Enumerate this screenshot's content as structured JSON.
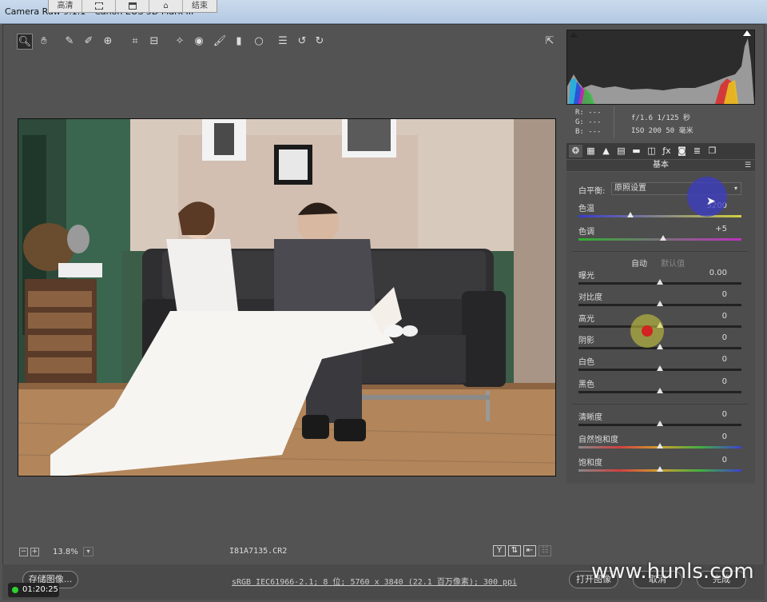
{
  "window": {
    "title": "Camera Raw 9.1.1 - Canon EOS 5D Mark III"
  },
  "recorder": {
    "buttons": [
      "高清",
      "",
      "",
      "",
      "结束"
    ]
  },
  "toolbar": {
    "tools": [
      "zoom-icon",
      "hand-icon",
      "white-balance-icon",
      "color-sampler-icon",
      "target-adjust-icon",
      "crop-icon",
      "straighten-icon",
      "spot-removal-icon",
      "red-eye-icon",
      "adjustment-brush-icon",
      "graduated-filter-icon",
      "radial-filter-icon",
      "preferences-icon",
      "rotate-left-icon",
      "rotate-right-icon"
    ],
    "export_icon": "export-icon"
  },
  "image": {
    "filename": "I81A7135.CR2",
    "zoom": "13.8%"
  },
  "info": {
    "r": "R: ---",
    "g": "G: ---",
    "b": "B: ---",
    "exposure": "f/1.6   1/125 秒",
    "iso": "ISO 200   50 毫米"
  },
  "panel": {
    "title": "基本",
    "white_balance_label": "白平衡:",
    "white_balance_value": "原照设置",
    "auto": "自动",
    "default": "默认值",
    "sliders": [
      {
        "label": "色温",
        "value": "5200",
        "pos": 0.32
      },
      {
        "label": "色调",
        "value": "+5",
        "pos": 0.52
      },
      {
        "label": "曝光",
        "value": "0.00",
        "pos": 0.5
      },
      {
        "label": "对比度",
        "value": "0",
        "pos": 0.5
      },
      {
        "label": "高光",
        "value": "0",
        "pos": 0.5
      },
      {
        "label": "阴影",
        "value": "0",
        "pos": 0.5
      },
      {
        "label": "白色",
        "value": "0",
        "pos": 0.5
      },
      {
        "label": "黑色",
        "value": "0",
        "pos": 0.5
      },
      {
        "label": "清晰度",
        "value": "0",
        "pos": 0.5
      },
      {
        "label": "自然饱和度",
        "value": "0",
        "pos": 0.5
      },
      {
        "label": "饱和度",
        "value": "0",
        "pos": 0.5
      }
    ]
  },
  "footer": {
    "save": "存储图像...",
    "workflow": "sRGB IEC61966-2.1; 8 位; 5760 x 3840 (22.1 百万像素); 300 ppi",
    "open": "打开图像",
    "cancel": "取消",
    "done": "完成"
  },
  "watermark": "www.hunls.com",
  "timer": "01:20:25",
  "colors": {
    "background": "#535353",
    "panel": "#4d4d4d",
    "histogram_bg": "#2c2c2c",
    "cursor_blue": "#3c3cc8",
    "cursor_red": "#d32222"
  }
}
